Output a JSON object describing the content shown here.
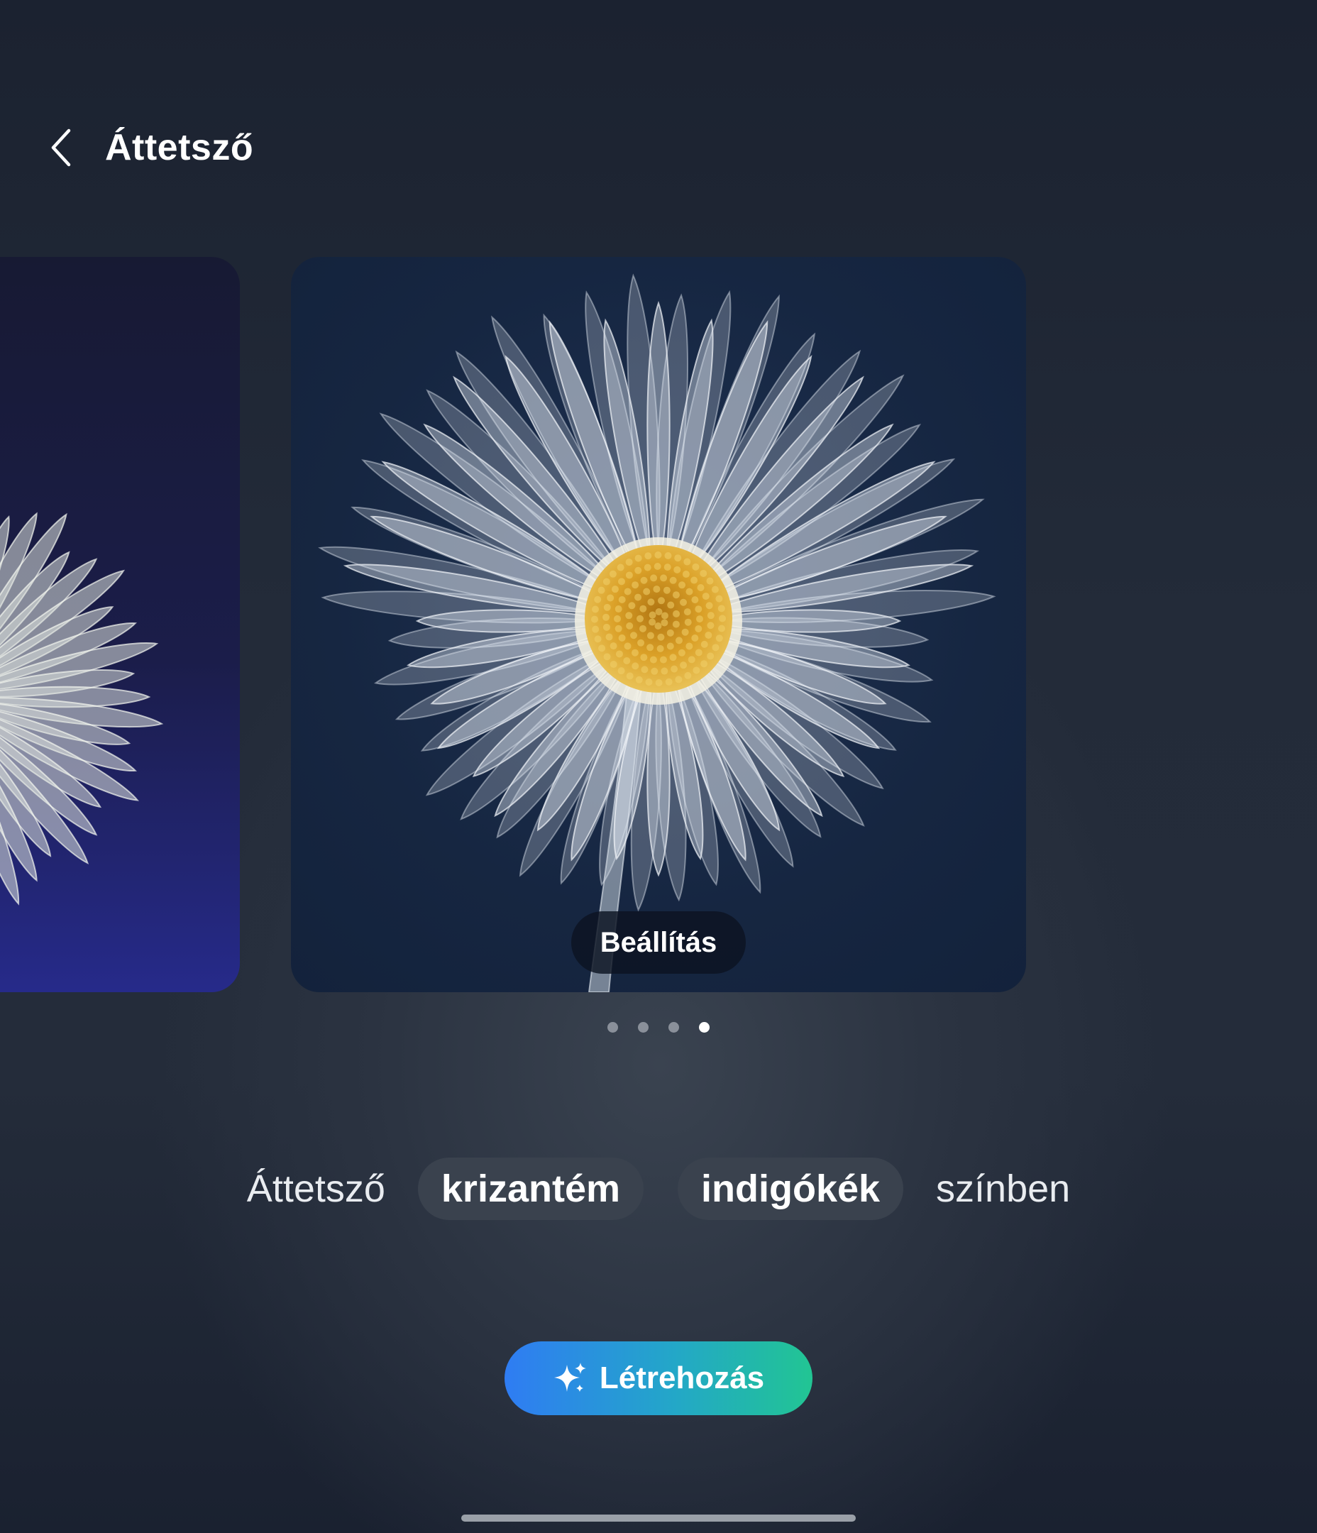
{
  "header": {
    "back_icon": "chevron-left-icon",
    "title": "Áttetsző"
  },
  "carousel": {
    "total_items": 4,
    "active_index": 3,
    "set_button_label": "Beállítás"
  },
  "prompt": {
    "prefix": "Áttetsző",
    "chip1": "krizantém",
    "chip2": "indigókék",
    "suffix": "színben"
  },
  "actions": {
    "create_icon": "sparkle-icon",
    "create_label": "Létrehozás"
  },
  "colors": {
    "accent_start": "#2f7cf3",
    "accent_end": "#22c593",
    "flower_center": "#e0a82a"
  }
}
